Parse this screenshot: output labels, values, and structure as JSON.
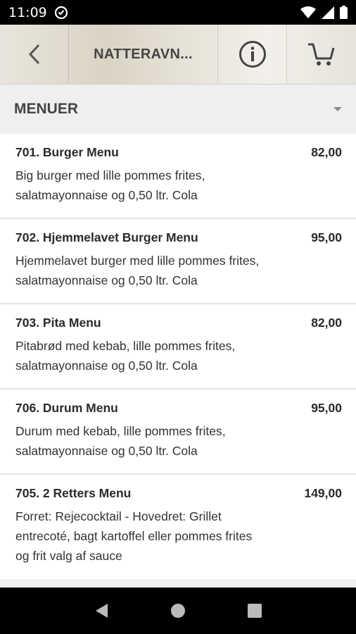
{
  "status_bar": {
    "time": "11:09",
    "icons": [
      "do-not-disturb-icon",
      "wifi-icon",
      "signal-icon",
      "battery-icon"
    ]
  },
  "header": {
    "title": "NATTERAVN...",
    "back_icon": "back-arrow-icon",
    "info_icon": "info-icon",
    "cart_icon": "cart-icon"
  },
  "category": {
    "label": "MENUER",
    "caret_icon": "dropdown-caret-icon"
  },
  "menu_items": [
    {
      "name": "701. Burger Menu",
      "price": "82,00",
      "desc_lines": [
        "Big burger med lille pommes frites,",
        "salatmayonnaise og 0,50 ltr. Cola"
      ]
    },
    {
      "name": "702. Hjemmelavet Burger Menu",
      "price": "95,00",
      "desc_lines": [
        "Hjemmelavet burger med lille pommes frites,",
        "salatmayonnaise og 0,50 ltr. Cola"
      ]
    },
    {
      "name": "703. Pita Menu",
      "price": "82,00",
      "desc_lines": [
        "Pitabrød med kebab, lille pommes frites,",
        "salatmayonnaise og 0,50 ltr. Cola"
      ]
    },
    {
      "name": "706. Durum Menu",
      "price": "95,00",
      "desc_lines": [
        "Durum med kebab, lille pommes frites,",
        "salatmayonnaise og 0,50 ltr. Cola"
      ]
    },
    {
      "name": "705. 2 Retters Menu",
      "price": "149,00",
      "desc_lines": [
        "Forret: Rejecocktail - Hovedret: Grillet",
        "entrecoté, bagt kartoffel eller pommes frites",
        "og frit valg af sauce"
      ]
    }
  ],
  "nav_bar": {
    "icons": [
      "nav-back-icon",
      "nav-home-icon",
      "nav-recents-icon"
    ]
  }
}
